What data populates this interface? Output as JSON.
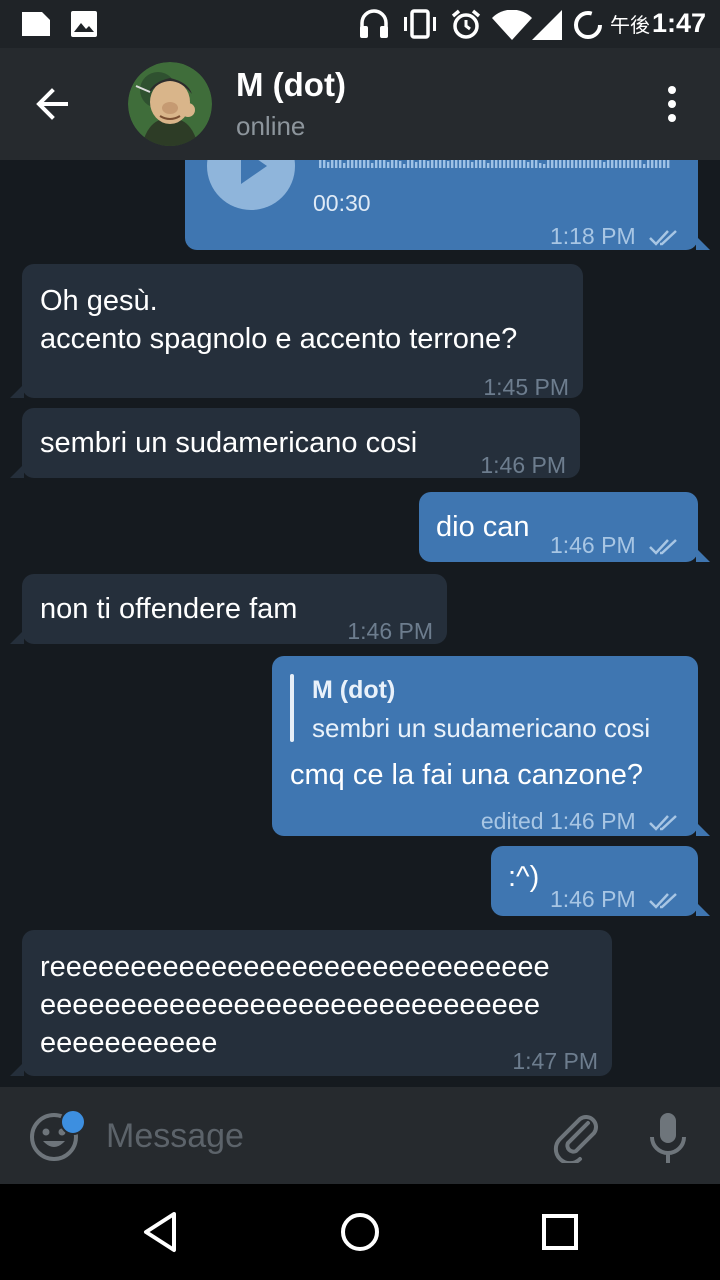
{
  "status_bar": {
    "time": "1:47",
    "time_prefix": "午後",
    "icons": [
      "notification-icon",
      "image-icon",
      "headphones-icon",
      "vibrate-icon",
      "alarm-icon",
      "wifi-icon",
      "signal-icon",
      "battery-icon"
    ]
  },
  "header": {
    "title": "M (dot)",
    "status": "online",
    "icons": [
      "back-arrow-icon",
      "avatar",
      "more-vert-icon"
    ]
  },
  "messages": [
    {
      "direction": "out",
      "type": "voice",
      "duration": "00:30",
      "time": "1:18 PM",
      "read": true
    },
    {
      "direction": "in",
      "lines": [
        "Oh gesù.",
        "accento spagnolo e accento terrone?"
      ],
      "time": "1:45 PM"
    },
    {
      "direction": "in",
      "text": "sembri un sudamericano cosi",
      "time": "1:46 PM"
    },
    {
      "direction": "out",
      "text": "dio can",
      "time": "1:46 PM",
      "read": true
    },
    {
      "direction": "in",
      "text": "non ti offendere fam",
      "time": "1:46 PM"
    },
    {
      "direction": "out",
      "reply_to": {
        "name": "M (dot)",
        "text": "sembri un sudamericano cosi"
      },
      "text": "cmq ce la fai una canzone?",
      "time": "edited 1:46 PM",
      "read": true
    },
    {
      "direction": "out",
      "text": ":^)",
      "time": "1:46 PM",
      "read": true
    },
    {
      "direction": "in",
      "lines": [
        "reeeeeeeeeeeeeeeeeeeeeeeeeeeeeee",
        "eeeeeeeeeeeeeeeeeeeeeeeeeeeeeee",
        "eeeeeeeeeee"
      ],
      "time": "1:47 PM"
    }
  ],
  "input": {
    "placeholder": "Message",
    "icons": [
      "emoji-icon",
      "attach-icon",
      "mic-icon"
    ]
  },
  "colors": {
    "background": "#151a1f",
    "header": "#262a2e",
    "incoming_bubble": "#252f3b",
    "outgoing_bubble": "#3f76b1",
    "accent": "#3d8fe0"
  }
}
